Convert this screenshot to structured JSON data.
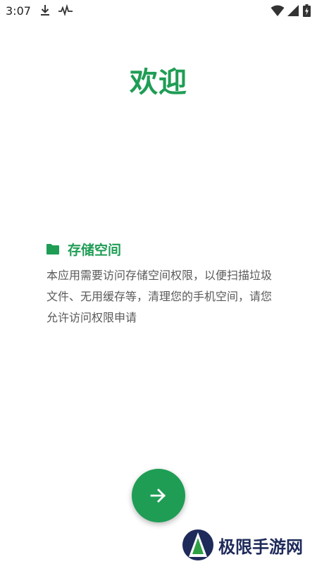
{
  "status_bar": {
    "time": "3:07",
    "icons": [
      "download-icon",
      "activity-icon",
      "wifi-icon",
      "signal-icon",
      "battery-icon"
    ]
  },
  "title": "欢迎",
  "permission": {
    "icon": "folder-icon",
    "title": "存储空间",
    "description": "本应用需要访问存储空间权限，以便扫描垃圾文件、无用缓存等，清理您的手机空间，请您允许访问权限申请"
  },
  "next_button": {
    "icon": "arrow-right-icon"
  },
  "watermark": {
    "text": "极限手游网"
  },
  "colors": {
    "accent": "#1f9d55",
    "text_secondary": "#5a5a5a",
    "background": "#ffffff"
  }
}
